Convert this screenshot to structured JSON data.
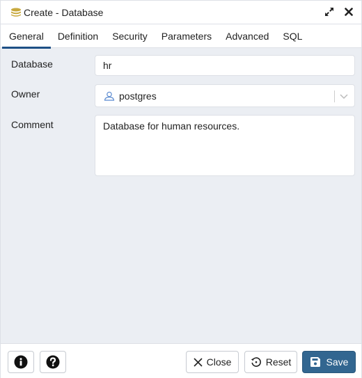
{
  "window": {
    "title": "Create - Database",
    "title_icon": "database-icon",
    "actions": [
      {
        "name": "maximize",
        "icon": "expand-arrows-icon"
      },
      {
        "name": "close",
        "icon": "close-x-icon"
      }
    ]
  },
  "tabs": [
    {
      "label": "General",
      "active": true
    },
    {
      "label": "Definition",
      "active": false
    },
    {
      "label": "Security",
      "active": false
    },
    {
      "label": "Parameters",
      "active": false
    },
    {
      "label": "Advanced",
      "active": false
    },
    {
      "label": "SQL",
      "active": false
    }
  ],
  "form": {
    "database": {
      "label": "Database",
      "value": "hr"
    },
    "owner": {
      "label": "Owner",
      "value": "postgres",
      "icon": "user-icon"
    },
    "comment": {
      "label": "Comment",
      "value": "Database for human resources."
    }
  },
  "footer": {
    "info_icon": "info-circle-icon",
    "help_icon": "question-circle-icon",
    "close_label": "Close",
    "reset_label": "Reset",
    "save_label": "Save"
  },
  "colors": {
    "accent": "#1e5086",
    "save_button": "#326690",
    "background": "#ebeef3",
    "database_icon": "#c8a93e",
    "user_icon": "#5b8bd0"
  }
}
